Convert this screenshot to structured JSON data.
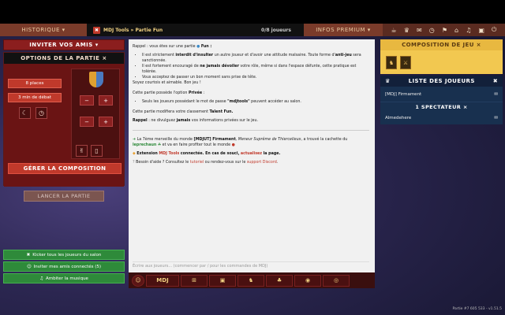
{
  "nav": {
    "historique": "HISTORIQUE",
    "mdj_title": "MDJ Tools » Partie Fun",
    "joueurs": "0/8 joueurs",
    "premium": "INFOS PREMIUM"
  },
  "left": {
    "inviter": "INVITER VOS AMIS",
    "options_title": "OPTIONS DE LA PARTIE ×",
    "places": "8 places",
    "debat": "3 min de débat",
    "gerer": "GÉRER LA COMPOSITION",
    "lancer": "LANCER LA PARTIE",
    "kicker": "Kicker tous les joueurs du salon",
    "inviter_amis": "Inviter mes amis connectés (5)",
    "musique": "Ambiter la musique"
  },
  "chat": {
    "rappel_intro": "Rappel : vous êtes sur une partie",
    "fun": "Fun :",
    "li1a": "Il est strictement",
    "li1b": "interdit d'insulter",
    "li1c": "un autre joueur et d'avoir une attitude malsaine. Toute forme d'",
    "li1d": "anti-jeu",
    "li1e": "sera sanctionnée.",
    "li2a": "Il est fortement encouragé de",
    "li2b": "ne jamais dévoiler",
    "li2c": "votre rôle, même si dans l'espace défunte, cette pratique est tolérée.",
    "li3": "Vous acceptez de passer un bon moment sans prise de tête.",
    "courtois": "Soyez courtois et aimable. Bon jeu !",
    "privee_a": "Cette partie possède l'option",
    "privee_b": "Privée",
    "privee_li_a": "Seuls les joueurs possédant le mot de passe",
    "privee_li_b": "\"mdjtools\"",
    "privee_li_c": "peuvent accéder au salon.",
    "talent_a": "Cette partie modifiera votre classement",
    "talent_b": "Talent Fun.",
    "rappel2_a": "Rappel",
    "rappel2_b": ": ne divulguez",
    "rappel2_c": "jamais",
    "rappel2_d": "vos informations privées sur le jeu.",
    "msg1a": "La 7ème merveille du monde",
    "msg1b": "[MDJUT] Firmament",
    "msg1c": ", Meneur Suprême de Thiercelieux",
    "msg1d": ", a trouvé la cachette du",
    "msg1e": "leprechaun",
    "msg1f": "et va en faire profiter tout le monde",
    "ext_a": "Extension",
    "ext_b": "MDJ Tools",
    "ext_c": "connectée. En cas de souci,",
    "ext_d": "actualisez",
    "ext_e": "la page.",
    "aide_a": "Besoin d'aide ? Consultez le",
    "aide_b": "tutoriel",
    "aide_c": "ou rendez-vous sur le",
    "aide_d": "support Discord",
    "input_placeholder": "Écrire aux joueurs... (commencer par / pour les commandes de MDJ)",
    "mdj_tab": "MDJ"
  },
  "right": {
    "compo_title": "COMPOSITION DE JEU ×",
    "liste_title": "LISTE DES JOUEURS",
    "player1": "[MDJ] Firmament",
    "spect_title": "1 SPECTATEUR ×",
    "spect1": "Almedehere"
  },
  "footer": "Partie #7 605 533 - v1.51.5"
}
